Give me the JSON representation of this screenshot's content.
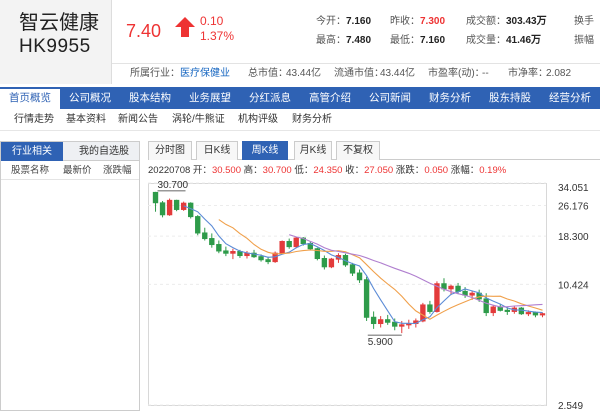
{
  "stock": {
    "name": "智云健康",
    "code": "HK9955",
    "price": "7.40",
    "change": "0.10",
    "change_pct": "1.37%"
  },
  "stats": {
    "open_label": "今开：",
    "open": "7.160",
    "prev_close_label": "昨收：",
    "prev_close": "7.300",
    "turnover_label": "成交额：",
    "turnover": "303.43万",
    "turnover_rate_label": "换手",
    "high_label": "最高：",
    "high": "7.480",
    "low_label": "最低：",
    "low": "7.160",
    "volume_label": "成交量：",
    "volume": "41.46万",
    "amplitude_label": "振幅"
  },
  "info": {
    "industry_label": "所属行业：",
    "industry": "医疗保健业",
    "total_mv_label": "总市值：",
    "total_mv": "43.44亿",
    "float_mv_label": "流通市值：",
    "float_mv": "43.44亿",
    "pe_label": "市盈率(动)：",
    "pe": "--",
    "pb_label": "市净率：",
    "pb": "2.082"
  },
  "nav": {
    "items": [
      "首页概览",
      "公司概况",
      "股本结构",
      "业务展望",
      "分红派息",
      "高管介绍",
      "公司新闻",
      "财务分析",
      "股东持股",
      "经营分析"
    ]
  },
  "subnav": {
    "items": [
      "行情走势",
      "基本资料",
      "新闻公告",
      "涡轮/牛熊证",
      "机构评级",
      "财务分析"
    ]
  },
  "left_panel": {
    "tab_industry": "行业相关",
    "tab_watchlist": "我的自选股",
    "col_name": "股票名称",
    "col_price": "最新价",
    "col_change": "涨跌幅"
  },
  "chart_tabs": [
    "分时图",
    "日K线",
    "周K线",
    "月K线",
    "不复权"
  ],
  "chart_info": {
    "date": "20220708",
    "open_label": "开：",
    "open": "30.500",
    "high_label": "高：",
    "high": "30.700",
    "low_label": "低：",
    "low": "24.350",
    "close_label": "收：",
    "close": "27.050",
    "chg_label": "涨跌：",
    "chg": "0.050",
    "chg_pct_label": "涨幅：",
    "chg_pct": "0.19%"
  },
  "chart_data": {
    "type": "candlestick",
    "scale": "log",
    "y_ticks": [
      "34.051",
      "26.176",
      "18.300",
      "10.424",
      "2.549"
    ],
    "annotations": {
      "max_label": "30.700",
      "min_label": "5.900"
    },
    "colors": {
      "up": "#e33b3b",
      "down": "#2e9b4a",
      "ma_short": "#5b8bd6",
      "ma_mid": "#f0a04b",
      "ma_long": "#b07fcf"
    },
    "candles": [
      [
        30.5,
        30.7,
        24.35,
        27.05
      ],
      [
        27.0,
        27.6,
        22.8,
        23.5
      ],
      [
        23.5,
        28.4,
        23.2,
        27.8
      ],
      [
        27.8,
        28.0,
        24.5,
        25.0
      ],
      [
        25.0,
        27.4,
        24.6,
        26.9
      ],
      [
        26.9,
        27.2,
        22.5,
        23.0
      ],
      [
        23.0,
        23.4,
        18.5,
        19.0
      ],
      [
        19.0,
        20.2,
        17.4,
        17.8
      ],
      [
        17.8,
        18.9,
        16.0,
        16.6
      ],
      [
        16.6,
        17.4,
        15.0,
        15.4
      ],
      [
        15.4,
        16.2,
        14.5,
        15.0
      ],
      [
        15.0,
        15.8,
        14.0,
        15.3
      ],
      [
        15.3,
        15.6,
        14.2,
        14.6
      ],
      [
        14.6,
        15.4,
        14.1,
        15.0
      ],
      [
        15.0,
        15.6,
        14.2,
        14.4
      ],
      [
        14.4,
        14.8,
        13.6,
        13.9
      ],
      [
        13.9,
        14.4,
        13.2,
        13.6
      ],
      [
        13.6,
        15.3,
        13.4,
        15.0
      ],
      [
        15.0,
        17.4,
        14.8,
        17.2
      ],
      [
        17.2,
        17.8,
        15.8,
        16.2
      ],
      [
        16.2,
        18.2,
        15.9,
        17.9
      ],
      [
        17.9,
        18.1,
        16.4,
        16.8
      ],
      [
        16.8,
        17.3,
        15.5,
        15.8
      ],
      [
        15.8,
        16.0,
        13.8,
        14.1
      ],
      [
        14.1,
        14.6,
        12.4,
        12.8
      ],
      [
        12.8,
        14.2,
        12.6,
        14.0
      ],
      [
        14.0,
        15.0,
        13.4,
        14.6
      ],
      [
        14.6,
        14.9,
        12.8,
        13.1
      ],
      [
        13.1,
        13.4,
        11.5,
        11.9
      ],
      [
        11.9,
        12.4,
        10.6,
        11.0
      ],
      [
        11.0,
        11.4,
        6.8,
        7.1
      ],
      [
        7.1,
        7.6,
        6.2,
        6.6
      ],
      [
        6.6,
        7.2,
        6.3,
        6.9
      ],
      [
        6.9,
        7.3,
        6.5,
        6.7
      ],
      [
        6.7,
        7.0,
        6.1,
        6.4
      ],
      [
        6.4,
        6.8,
        5.9,
        6.5
      ],
      [
        6.5,
        6.9,
        6.2,
        6.6
      ],
      [
        6.6,
        7.0,
        6.3,
        6.8
      ],
      [
        6.8,
        8.4,
        6.7,
        8.2
      ],
      [
        8.2,
        8.6,
        7.4,
        7.6
      ],
      [
        7.6,
        10.8,
        7.5,
        10.5
      ],
      [
        10.5,
        11.2,
        9.6,
        9.9
      ],
      [
        9.9,
        10.4,
        9.2,
        10.2
      ],
      [
        10.2,
        10.6,
        9.3,
        9.6
      ],
      [
        9.6,
        10.1,
        8.9,
        9.2
      ],
      [
        9.2,
        9.7,
        8.7,
        9.4
      ],
      [
        9.4,
        9.8,
        8.5,
        8.8
      ],
      [
        8.8,
        9.4,
        7.2,
        7.5
      ],
      [
        7.5,
        8.2,
        7.2,
        8.0
      ],
      [
        8.0,
        8.3,
        7.6,
        7.7
      ],
      [
        7.7,
        8.0,
        7.3,
        7.6
      ],
      [
        7.6,
        8.1,
        7.4,
        7.9
      ],
      [
        7.9,
        8.0,
        7.3,
        7.4
      ],
      [
        7.4,
        7.7,
        7.2,
        7.5
      ],
      [
        7.5,
        7.6,
        7.1,
        7.3
      ],
      [
        7.3,
        7.5,
        7.1,
        7.4
      ]
    ]
  }
}
